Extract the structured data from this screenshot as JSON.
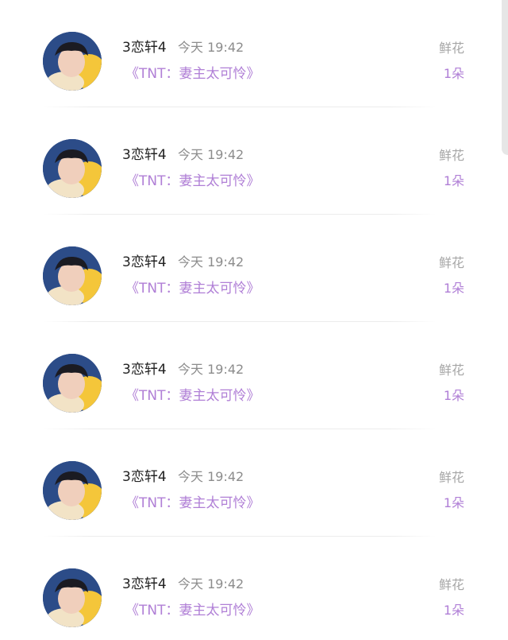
{
  "list": {
    "items": [
      {
        "username": "3恋轩4",
        "time": "今天 19:42",
        "book": "《TNT：妻主太可怜》",
        "gift_type": "鲜花",
        "gift_count": "1朵"
      },
      {
        "username": "3恋轩4",
        "time": "今天 19:42",
        "book": "《TNT：妻主太可怜》",
        "gift_type": "鲜花",
        "gift_count": "1朵"
      },
      {
        "username": "3恋轩4",
        "time": "今天 19:42",
        "book": "《TNT：妻主太可怜》",
        "gift_type": "鲜花",
        "gift_count": "1朵"
      },
      {
        "username": "3恋轩4",
        "time": "今天 19:42",
        "book": "《TNT：妻主太可怜》",
        "gift_type": "鲜花",
        "gift_count": "1朵"
      },
      {
        "username": "3恋轩4",
        "time": "今天 19:42",
        "book": "《TNT：妻主太可怜》",
        "gift_type": "鲜花",
        "gift_count": "1朵"
      },
      {
        "username": "3恋轩4",
        "time": "今天 19:42",
        "book": "《TNT：妻主太可怜》",
        "gift_type": "鲜花",
        "gift_count": "1朵"
      }
    ]
  },
  "colors": {
    "accent": "#b07fd6",
    "muted": "#a6a6a6",
    "text": "#222222"
  }
}
